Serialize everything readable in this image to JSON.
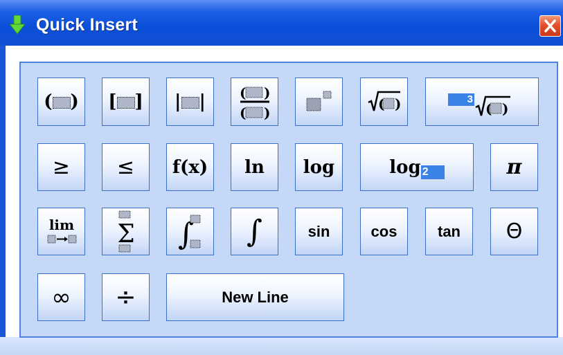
{
  "window": {
    "title": "Quick Insert"
  },
  "buttons": {
    "geq": "≥",
    "leq": "≤",
    "function": "f(x)",
    "ln": "ln",
    "log": "log",
    "log_base": "log",
    "log_base_value": "2",
    "pi": "π",
    "lim": "lim",
    "sigma": "Σ",
    "integral": "∫",
    "sin": "sin",
    "cos": "cos",
    "tan": "tan",
    "theta": "Θ",
    "infinity": "∞",
    "divide": "÷",
    "new_line": "New Line",
    "nth_root_index": "3"
  }
}
